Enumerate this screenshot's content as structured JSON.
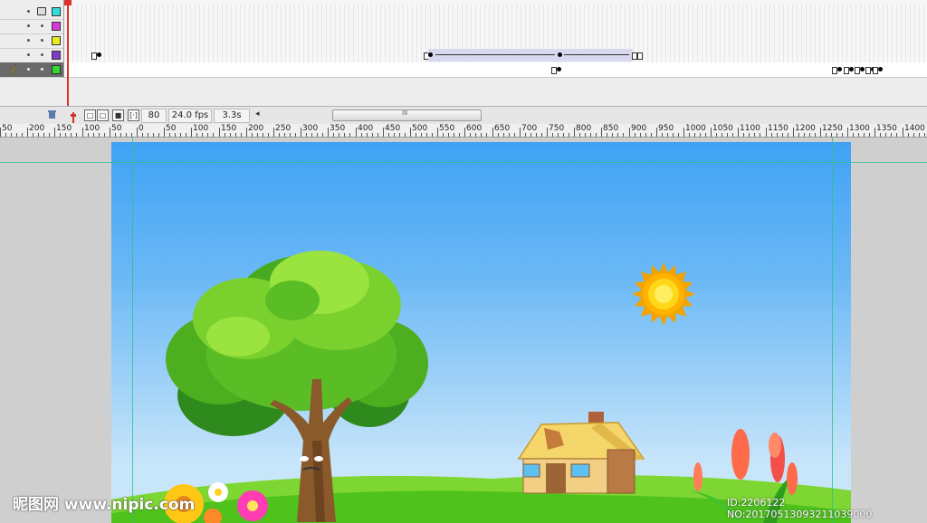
{
  "timeline": {
    "layers": [
      {
        "id": "layer-1",
        "locked": true,
        "color": "#33dede",
        "selected": false
      },
      {
        "id": "layer-2",
        "locked": false,
        "color": "#d838d8",
        "selected": false
      },
      {
        "id": "layer-3",
        "locked": false,
        "color": "#eaea20",
        "selected": false
      },
      {
        "id": "layer-4",
        "locked": false,
        "color": "#7d3cc8",
        "selected": false
      },
      {
        "id": "layer-5",
        "locked": false,
        "color": "#30d830",
        "selected": true
      }
    ],
    "lock_icon": "lock-icon",
    "pencil_icon": "pencil-icon"
  },
  "statusbar": {
    "frame": "80",
    "fps": "24.0 fps",
    "time": "3.3s",
    "scroll_grip": "III",
    "scroll_left": "◂"
  },
  "ruler": {
    "labels": [
      "50",
      "200",
      "150",
      "100",
      "50",
      "0",
      "50",
      "100",
      "150",
      "200",
      "250",
      "300",
      "350",
      "400",
      "450",
      "500",
      "550",
      "600",
      "650",
      "700",
      "750",
      "800",
      "850",
      "900",
      "950",
      "1000",
      "1050",
      "1100",
      "1150",
      "1200",
      "1250",
      "1300",
      "1350",
      "1400"
    ]
  },
  "stage": {
    "background_top": "#3fa2f4",
    "background_bottom": "#c8e6fa",
    "grass_color": "#4fc21c"
  },
  "watermark": {
    "left": "昵图网 www.nipic.com",
    "right": "ID:2206122 NO:20170513093211039000"
  }
}
